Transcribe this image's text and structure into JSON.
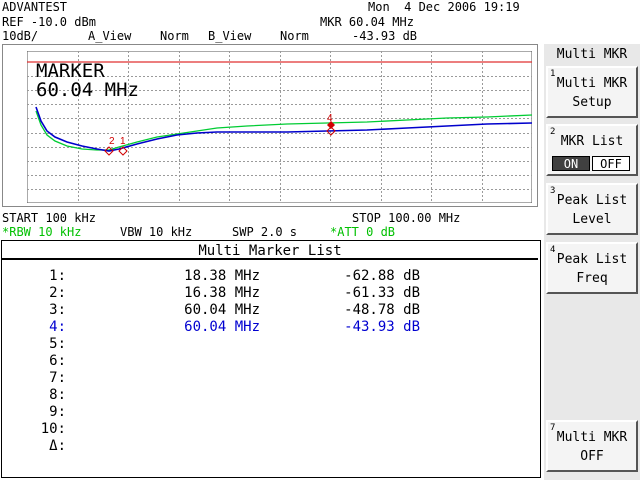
{
  "header": {
    "brand": "ADVANTEST",
    "datetime": "Mon  4 Dec 2006 19:19",
    "ref_level": "REF -10.0 dBm",
    "marker_freq": "MKR 60.04 MHz",
    "scale": "10dB/",
    "a_view": "A_View",
    "a_view_mode": "Norm",
    "b_view": "B_View",
    "b_view_mode": "Norm",
    "marker_level": "-43.93 dB"
  },
  "graph": {
    "marker_label": "MARKER",
    "marker_value": "60.04 MHz",
    "start": "START 100 kHz",
    "stop": "STOP 100.00 MHz",
    "rbw": "*RBW 10 kHz",
    "vbw": "VBW 10 kHz",
    "swp": "SWP 2.0 s",
    "att": "*ATT 0 dB",
    "trace_a_color": "#0000cc",
    "trace_b_color": "#00cc33",
    "ref_line_color": "#e03030",
    "marker_color": "#d00000",
    "marker_tags": [
      "2",
      "1",
      "4"
    ]
  },
  "marker_list": {
    "title": "Multi Marker List",
    "rows": [
      {
        "no": "1:",
        "freq": "18.38 MHz",
        "level": "-62.88 dB"
      },
      {
        "no": "2:",
        "freq": "16.38 MHz",
        "level": "-61.33 dB"
      },
      {
        "no": "3:",
        "freq": "60.04 MHz",
        "level": "-48.78 dB"
      },
      {
        "no": "4:",
        "freq": "60.04 MHz",
        "level": "-43.93 dB"
      },
      {
        "no": "5:",
        "freq": "",
        "level": ""
      },
      {
        "no": "6:",
        "freq": "",
        "level": ""
      },
      {
        "no": "7:",
        "freq": "",
        "level": ""
      },
      {
        "no": "8:",
        "freq": "",
        "level": ""
      },
      {
        "no": "9:",
        "freq": "",
        "level": ""
      },
      {
        "no": "10:",
        "freq": "",
        "level": ""
      },
      {
        "no": "Δ:",
        "freq": "",
        "level": ""
      }
    ]
  },
  "softkeys": {
    "title": "Multi MKR",
    "keys": [
      {
        "num": "1",
        "line1": "Multi MKR",
        "line2": "Setup"
      },
      {
        "num": "2",
        "line1": "MKR List",
        "on": "ON",
        "off": "OFF"
      },
      {
        "num": "3",
        "line1": "Peak List",
        "line2": "Level"
      },
      {
        "num": "4",
        "line1": "Peak List",
        "line2": "Freq"
      },
      {
        "num": "7",
        "line1": "Multi MKR",
        "line2": "OFF"
      }
    ]
  }
}
